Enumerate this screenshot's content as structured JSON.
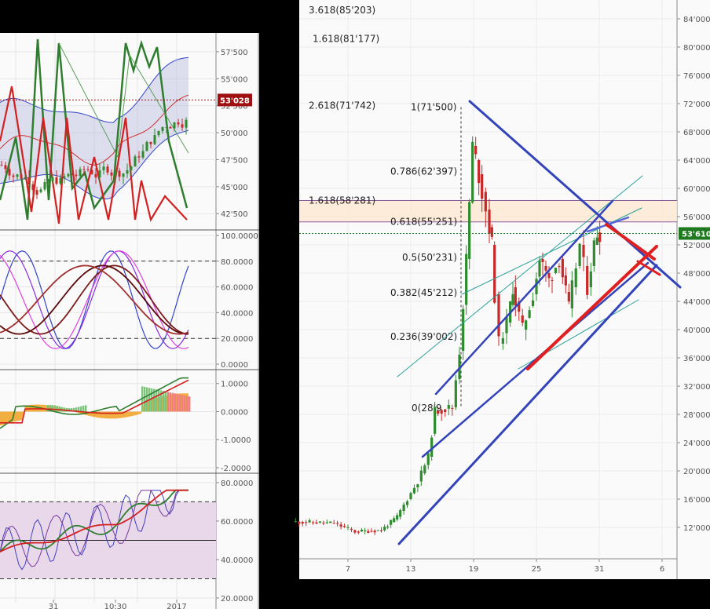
{
  "chart_data": [
    {
      "type": "line",
      "panel": "left-price",
      "yticks": [
        "57'500",
        "55'000",
        "52'500",
        "50'000",
        "47'500",
        "45'000",
        "42'500"
      ],
      "ylim": [
        41500,
        58800
      ],
      "last_price_label": "53'028",
      "last_price": 53028,
      "grid": true
    },
    {
      "type": "line",
      "panel": "left-stochastic",
      "yticks": [
        "100.0000",
        "80.0000",
        "60.0000",
        "40.0000",
        "20.0000",
        "0.0000"
      ],
      "ylim": [
        0,
        100
      ],
      "levels": [
        80,
        20
      ],
      "grid": true
    },
    {
      "type": "bar",
      "panel": "left-macd",
      "yticks": [
        "1.0000",
        "0.0000",
        "-1.0000",
        "-2.0000"
      ],
      "ylim": [
        -2,
        1.3
      ],
      "grid": true
    },
    {
      "type": "line",
      "panel": "left-rsi",
      "yticks": [
        "80.0000",
        "60.0000",
        "40.0000",
        "20.0000"
      ],
      "ylim": [
        20,
        82
      ],
      "band": [
        30,
        70
      ],
      "midline": 50,
      "xticks": [
        "31",
        "10:30",
        "2017"
      ],
      "grid": true
    },
    {
      "type": "candlestick",
      "panel": "right-main",
      "yticks": [
        "84'000",
        "80'000",
        "76'000",
        "72'000",
        "68'000",
        "64'000",
        "60'000",
        "56'000",
        "52'000",
        "48'000",
        "44'000",
        "40'000",
        "36'000",
        "32'000",
        "28'000",
        "24'000",
        "20'000",
        "16'000",
        "12'000"
      ],
      "ylim": [
        10000,
        86000
      ],
      "xticks": [
        "7",
        "13",
        "19",
        "25",
        "31",
        "6"
      ],
      "xlim": [
        2,
        9
      ],
      "last_price_label": "53'610",
      "last_price": 53610,
      "fib_levels": [
        {
          "label": "3.618(85'203)",
          "value": 85203
        },
        {
          "label": "1.618(81'177)",
          "value": 81177
        },
        {
          "label": "2.618(71'742)",
          "value": 71742
        },
        {
          "label": "1(71'500)",
          "value": 71500
        },
        {
          "label": "0.786(62'397)",
          "value": 62397
        },
        {
          "label": "1.618(58'281)",
          "value": 58281
        },
        {
          "label": "0.618(55'251)",
          "value": 55251
        },
        {
          "label": "0.5(50'231)",
          "value": 50231
        },
        {
          "label": "0.382(45'212)",
          "value": 45212
        },
        {
          "label": "0.236(39'002)",
          "value": 39002
        },
        {
          "label": "0(28'9",
          "value": 28900
        }
      ],
      "colors": {
        "up": "#2e8b2e",
        "down": "#c82828",
        "trend_blue": "#3344bb",
        "trend_red": "#e02020",
        "channel_teal": "#2aa198",
        "last_price": "#1f7a1f"
      },
      "grid": true
    }
  ]
}
